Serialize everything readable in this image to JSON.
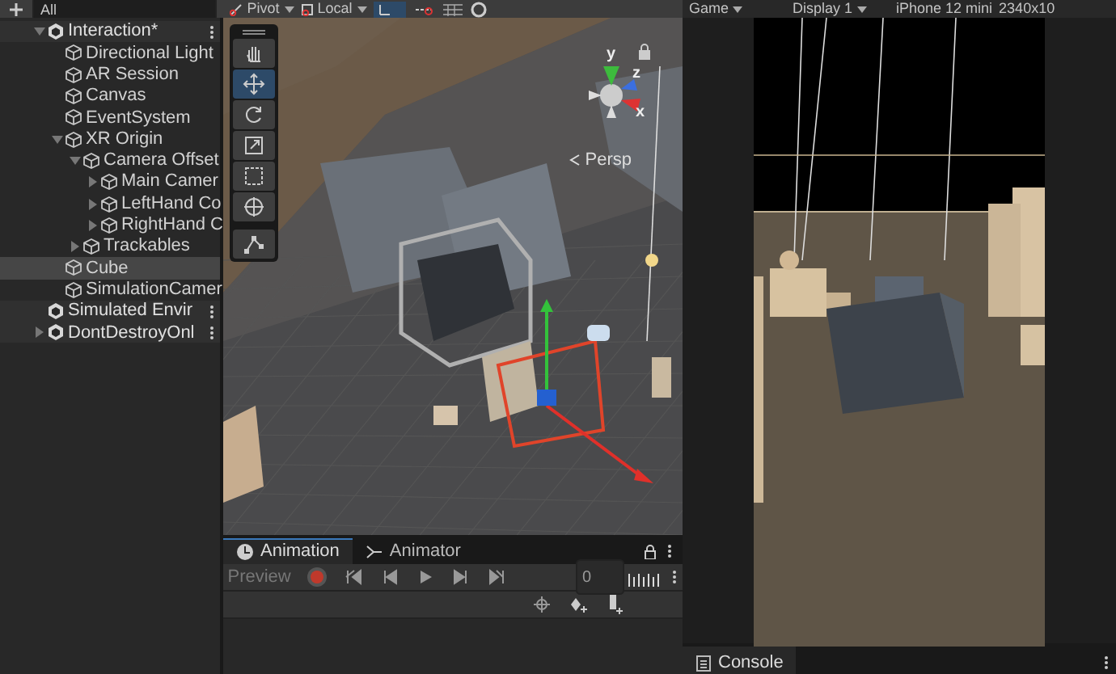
{
  "toolbar": {
    "pivot": "Pivot",
    "local": "Local"
  },
  "hierarchy": {
    "search_placeholder": "All",
    "items": [
      {
        "name": "Interaction*",
        "kind": "scene",
        "expanded": true,
        "selected": false,
        "children": [
          {
            "name": "Directional Light",
            "kind": "object",
            "selected": false
          },
          {
            "name": "AR Session",
            "kind": "object",
            "selected": false
          },
          {
            "name": "Canvas",
            "kind": "object",
            "selected": false
          },
          {
            "name": "EventSystem",
            "kind": "object",
            "selected": false
          },
          {
            "name": "XR Origin",
            "kind": "object",
            "expanded": true,
            "selected": false,
            "children": [
              {
                "name": "Camera Offset",
                "kind": "object",
                "expanded": true,
                "selected": false,
                "children": [
                  {
                    "name": "Main Camer",
                    "kind": "object",
                    "expanded": false,
                    "selected": false
                  },
                  {
                    "name": "LeftHand Co",
                    "kind": "object",
                    "expanded": false,
                    "selected": false
                  },
                  {
                    "name": "RightHand C",
                    "kind": "object",
                    "expanded": false,
                    "selected": false
                  }
                ]
              },
              {
                "name": "Trackables",
                "kind": "object",
                "expanded": false,
                "selected": false
              }
            ]
          },
          {
            "name": "Cube",
            "kind": "object",
            "selected": true
          },
          {
            "name": "SimulationCamer",
            "kind": "object",
            "selected": false
          }
        ]
      },
      {
        "name": "Simulated Envir",
        "kind": "scene",
        "selected": false
      },
      {
        "name": "DontDestroyOnl",
        "kind": "scene",
        "expanded": false,
        "selected": false
      }
    ]
  },
  "scene_view": {
    "camera_label": "Persp",
    "axes": [
      "y",
      "z",
      "x"
    ],
    "tools": [
      {
        "kind": "hand",
        "selected": false
      },
      {
        "kind": "move",
        "selected": true
      },
      {
        "kind": "rotate",
        "selected": false
      },
      {
        "kind": "scale",
        "selected": false
      },
      {
        "kind": "rect",
        "selected": false
      },
      {
        "kind": "transform",
        "selected": false
      },
      {
        "kind": "custom",
        "selected": false
      }
    ]
  },
  "animation_panel": {
    "tabs": [
      {
        "label": "Animation",
        "selected": true
      },
      {
        "label": "Animator",
        "selected": false
      }
    ],
    "preview": "Preview",
    "recording": false,
    "frame": "0"
  },
  "game_view": {
    "tab": "Game",
    "display": "Display 1",
    "device": "iPhone 12 mini",
    "resolution": "2340x10"
  },
  "console": {
    "tab": "Console"
  }
}
